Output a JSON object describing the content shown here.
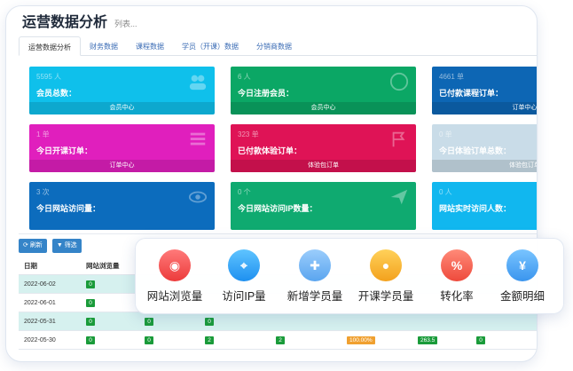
{
  "header": {
    "title": "运营数据分析",
    "subtitle": "列表..."
  },
  "tabs": [
    {
      "label": "运营数据分析",
      "active": true
    },
    {
      "label": "财务数据",
      "active": false
    },
    {
      "label": "课程数据",
      "active": false
    },
    {
      "label": "学员（开课）数据",
      "active": false
    },
    {
      "label": "分销商数据",
      "active": false
    }
  ],
  "cards": [
    {
      "num": "5595 人",
      "label": "会员总数：",
      "foot": "会员中心",
      "color": "#0fc0eb",
      "icon": "users-icon"
    },
    {
      "num": "6 人",
      "label": "今日注册会员：",
      "foot": "会员中心",
      "color": "#0ba765",
      "icon": "registered-icon"
    },
    {
      "num": "4661 单",
      "label": "已付款课程订单：",
      "foot": "订单中心",
      "color": "#0d66b4",
      "icon": "order-icon"
    },
    {
      "num": "1 单",
      "label": "今日开课订单：",
      "foot": "订单中心",
      "color": "#e01fbd",
      "icon": "list-icon"
    },
    {
      "num": "323 单",
      "label": "已付款体验订单：",
      "foot": "体验包订单",
      "color": "#df1356",
      "icon": "flag-icon"
    },
    {
      "num": "0 单",
      "label": "今日体验订单总数：",
      "foot": "体验包订单",
      "color": "#c9dce8",
      "icon": "chat-icon"
    },
    {
      "num": "3 次",
      "label": "今日网站访问量：",
      "foot": "",
      "color": "#0c6cbd",
      "icon": "eye-icon"
    },
    {
      "num": "0 个",
      "label": "今日网站访问IP数量：",
      "foot": "",
      "color": "#0faa70",
      "icon": "send-icon"
    },
    {
      "num": "0 人",
      "label": "网站实时访问人数：",
      "foot": "",
      "color": "#11b7ef",
      "icon": "chart-icon"
    }
  ],
  "toolbar": {
    "refresh_label": "刷新",
    "filter_label": "筛选"
  },
  "table": {
    "headers": [
      "日期",
      "网站浏览量"
    ],
    "rows": [
      {
        "date": "2022-06-02",
        "views": "0",
        "highlight": true,
        "extra": []
      },
      {
        "date": "2022-06-01",
        "views": "0",
        "highlight": false,
        "extra": []
      },
      {
        "date": "2022-05-31",
        "views": "0",
        "highlight": true,
        "extra": [
          "0",
          "0"
        ]
      },
      {
        "date": "2022-05-30",
        "views": "0",
        "highlight": false,
        "extra": [
          "0",
          "2",
          "2",
          "100.00%",
          "263.5",
          "0"
        ]
      }
    ]
  },
  "features": [
    {
      "label": "网站浏览量",
      "icon": "eye-icon",
      "glyph": "◉"
    },
    {
      "label": "访问IP量",
      "icon": "location-icon",
      "glyph": "⌖"
    },
    {
      "label": "新增学员量",
      "icon": "add-user-icon",
      "glyph": "✚"
    },
    {
      "label": "开课学员量",
      "icon": "user-icon",
      "glyph": "●"
    },
    {
      "label": "转化率",
      "icon": "percent-icon",
      "glyph": "%"
    },
    {
      "label": "金额明细",
      "icon": "yuan-icon",
      "glyph": "¥"
    }
  ]
}
